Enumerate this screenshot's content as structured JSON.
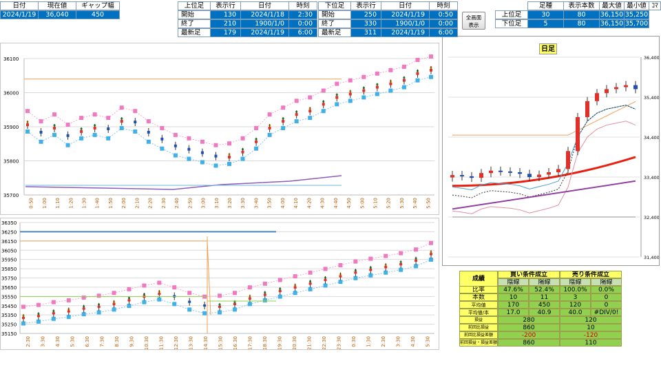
{
  "top_left": {
    "headers": [
      "日付",
      "現在値",
      "ギャップ幅"
    ],
    "values": [
      "2024/1/19",
      "36,040",
      "450"
    ]
  },
  "upper_bar": {
    "headers": [
      "上位足",
      "表示行",
      "日付",
      "時刻"
    ],
    "rows": [
      {
        "label": "開始",
        "rows": "130",
        "date": "2024/1/18",
        "time": "2:30"
      },
      {
        "label": "終了",
        "rows": "210",
        "date": "1900/1/0",
        "time": "0:00"
      },
      {
        "label": "最新足",
        "rows": "179",
        "date": "2024/1/19",
        "time": "6:00"
      }
    ]
  },
  "lower_bar": {
    "headers": [
      "下位足",
      "表示行",
      "日付",
      "時刻"
    ],
    "rows": [
      {
        "label": "開始",
        "rows": "250",
        "date": "2024/1/19",
        "time": "0:50"
      },
      {
        "label": "終了",
        "rows": "330",
        "date": "1900/1/0",
        "time": "0:00"
      },
      {
        "label": "最新足",
        "rows": "311",
        "date": "2024/1/19",
        "time": "6:00"
      }
    ]
  },
  "fullscreen_button": {
    "line1": "全画面",
    "line2": "表示"
  },
  "range_table": {
    "headers": [
      "足種",
      "表示本数",
      "最大値",
      "最小値",
      "ｺﾏ"
    ],
    "rows": [
      {
        "label": "上位足",
        "type": "30",
        "count": "80",
        "max": "36,150",
        "min": "35,250"
      },
      {
        "label": "下位足",
        "type": "5",
        "count": "80",
        "max": "36,150",
        "min": "35,700"
      }
    ]
  },
  "colors": {
    "value_blue": "#0070c0",
    "candle_up": "#e0302a",
    "candle_down": "#1f4fb0",
    "band_pink": "#f07ac0",
    "band_blue": "#42b0e8",
    "daily_ma": "#e82010",
    "stats_yellow": "#ffff66",
    "stats_green": "#92d050"
  },
  "chart_data": [
    {
      "type": "line",
      "name": "upper",
      "ylim": [
        35700,
        36100
      ],
      "yticks": [
        "36100",
        "36000",
        "35900",
        "35800",
        "35700"
      ],
      "xticks": [
        "0:50",
        "1:00",
        "1:10",
        "1:20",
        "1:30",
        "1:40",
        "1:50",
        "2:00",
        "2:10",
        "2:20",
        "2:30",
        "2:40",
        "2:50",
        "3:00",
        "3:10",
        "3:20",
        "3:30",
        "3:40",
        "3:50",
        "4:00",
        "4:10",
        "4:20",
        "4:30",
        "4:40",
        "4:50",
        "5:00",
        "5:10",
        "5:20",
        "5:30",
        "5:40",
        "5:50"
      ],
      "series": [
        {
          "values": [
            35910,
            35880,
            35900,
            35870,
            35890,
            35900,
            35890,
            35920,
            35910,
            35880,
            35860,
            35840,
            35830,
            35820,
            35810,
            35815,
            35830,
            35860,
            35900,
            35920,
            35940,
            35950,
            35970,
            35990,
            36000,
            36010,
            36020,
            36030,
            36040,
            36060,
            36070
          ]
        }
      ]
    },
    {
      "type": "line",
      "name": "lower",
      "ylim": [
        35150,
        36350
      ],
      "yticks": [
        "36350",
        "36250",
        "36150",
        "36050",
        "35950",
        "35850",
        "35750",
        "35650",
        "35550",
        "35450",
        "35350",
        "35250",
        "35150"
      ],
      "xticks": [
        "2:30",
        "3:30",
        "4:30",
        "5:30",
        "6:30",
        "7:30",
        "8:30",
        "9:30",
        "10:30",
        "11:30",
        "12:30",
        "13:30",
        "14:30",
        "15:30",
        "16:30",
        "17:30",
        "18:30",
        "19:30",
        "20:30",
        "21:30",
        "22:30",
        "23:30",
        "0:30",
        "1:30",
        "2:30",
        "3:30",
        "4:30",
        "5:30"
      ],
      "series": [
        {
          "values": [
            35330,
            35350,
            35380,
            35400,
            35430,
            35450,
            35480,
            35520,
            35560,
            35590,
            35540,
            35480,
            35440,
            35450,
            35480,
            35540,
            35580,
            35620,
            35660,
            35700,
            35740,
            35780,
            35820,
            35850,
            35880,
            35910,
            35950,
            36020
          ]
        }
      ]
    },
    {
      "type": "line",
      "name": "daily",
      "title": "日足",
      "ylim": [
        31400,
        36400
      ],
      "yticks": [
        "36,400",
        "35,400",
        "34,400",
        "33,400",
        "32,400",
        "31,400"
      ],
      "series": [
        {
          "values": [
            33450,
            33420,
            33380,
            33500,
            33560,
            33540,
            33520,
            33480,
            33400,
            33460,
            33520,
            33600,
            34050,
            34900,
            35300,
            35500,
            35600,
            35650,
            35700,
            35600
          ]
        }
      ]
    }
  ],
  "stats": {
    "title": "成績",
    "buy_header": "買い条件成立",
    "sell_header": "売り条件成立",
    "sub_headers": [
      "陰線",
      "陽線",
      "陰線",
      "陽線"
    ],
    "rows": [
      {
        "label": "比率",
        "values": [
          "47.6%",
          "52.4%",
          "100.0%",
          "0.0%"
        ]
      },
      {
        "label": "本数",
        "values": [
          "10",
          "11",
          "3",
          "0"
        ]
      },
      {
        "label": "平均値",
        "values": [
          "170",
          "450",
          "120",
          "0"
        ]
      },
      {
        "label": "平均値/本",
        "values": [
          "17.0",
          "40.9",
          "40.0",
          "#DIV/0!"
        ]
      }
    ],
    "merged_rows": [
      {
        "label": "損益",
        "buy": "280",
        "sell": "120"
      },
      {
        "label": "前回比損益",
        "buy": "860",
        "sell": "10"
      },
      {
        "label": "前回比損益差額",
        "buy": "-200",
        "sell": "-120"
      },
      {
        "label": "前回損益・損益差額",
        "buy": "860",
        "sell": "110"
      }
    ]
  }
}
